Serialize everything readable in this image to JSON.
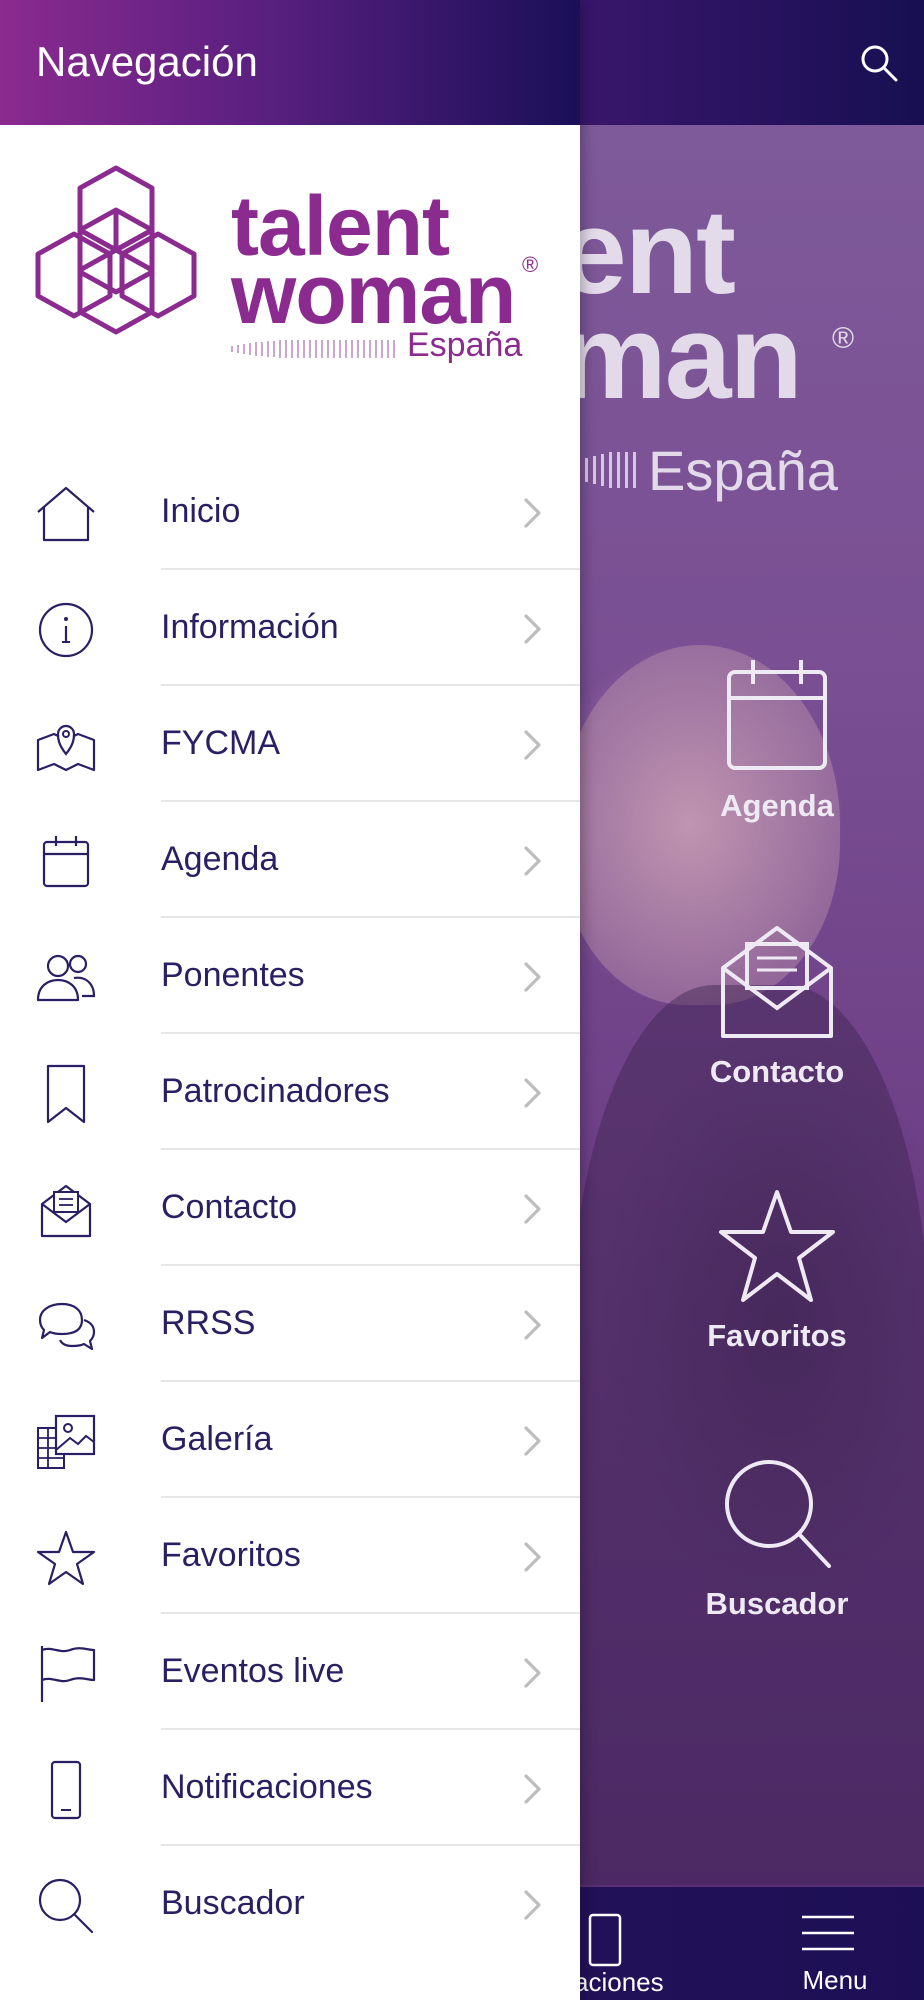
{
  "drawer": {
    "title": "Navegación",
    "brand": {
      "name_line1": "talent",
      "name_line2": "woman",
      "registered": "®",
      "country": "España"
    },
    "items": [
      {
        "label": "Inicio",
        "icon": "home-icon"
      },
      {
        "label": "Información",
        "icon": "info-icon"
      },
      {
        "label": "FYCMA",
        "icon": "map-icon"
      },
      {
        "label": "Agenda",
        "icon": "calendar-icon"
      },
      {
        "label": "Ponentes",
        "icon": "users-icon"
      },
      {
        "label": "Patrocinadores",
        "icon": "bookmark-icon"
      },
      {
        "label": "Contacto",
        "icon": "mail-icon"
      },
      {
        "label": "RRSS",
        "icon": "chat-icon"
      },
      {
        "label": "Galería",
        "icon": "gallery-icon"
      },
      {
        "label": "Favoritos",
        "icon": "star-icon"
      },
      {
        "label": "Eventos live",
        "icon": "flag-icon"
      },
      {
        "label": "Notificaciones",
        "icon": "phone-icon"
      },
      {
        "label": "Buscador",
        "icon": "search-icon"
      }
    ]
  },
  "background": {
    "hero_logo": {
      "line1": "ent",
      "line2": "man",
      "registered": "®",
      "country": "España"
    },
    "quick_actions": [
      {
        "label": "Agenda",
        "icon": "calendar-icon"
      },
      {
        "label": "Contacto",
        "icon": "mail-icon"
      },
      {
        "label": "Favoritos",
        "icon": "star-icon"
      },
      {
        "label": "Buscador",
        "icon": "search-icon"
      }
    ],
    "bottom_bar": {
      "notifications_label": "aciones",
      "menu_label": "Menu"
    }
  },
  "colors": {
    "brand_purple": "#8b2a8f",
    "header_dark": "#170f52",
    "text_dark": "#2a1f63"
  }
}
